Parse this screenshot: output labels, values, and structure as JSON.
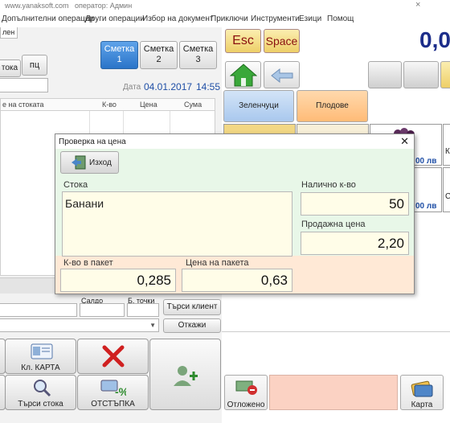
{
  "titlebar": {
    "site": "www.yanaksoft.com",
    "operator": "оператор: Админ",
    "close_symbol": "×"
  },
  "menu": [
    "Допълнителни операции",
    "Други операции",
    "Избор на документ",
    "Приключи",
    "Инструменти",
    "Езици",
    "Помощ"
  ],
  "tab_fragment": "лен",
  "left": {
    "stoka_fragment": "тока",
    "pc_label": "пц",
    "accounts": [
      {
        "title": "Сметка",
        "num": "1"
      },
      {
        "title": "Сметка",
        "num": "2"
      },
      {
        "title": "Сметка",
        "num": "3"
      }
    ],
    "date_label": "Дата",
    "date_value": "04.01.2017",
    "time_value": "14:55",
    "table_headers": [
      "е на стоката",
      "К-во",
      "Цена",
      "Сума"
    ],
    "saldo_label": "Салдо",
    "points_label": "Б. точки",
    "search_client": "Търси клиент",
    "cancel": "Откажи",
    "card_label": "Кл. КАРТА",
    "search_goods": "Търси стока",
    "discount": "ОТСТЪПКА"
  },
  "right": {
    "esc": "Esc",
    "space": "Space",
    "display_value": "0,0",
    "categories": [
      "Зеленчуци",
      "Плодове"
    ],
    "price_fragment_1": "00 лв",
    "price_fragment_2": "00 лв",
    "side_letter_1": "К",
    "side_letter_2": "С",
    "postponed": "Отложено",
    "card": "Карта"
  },
  "dialog": {
    "title": "Проверка на цена",
    "exit": "Изход",
    "goods_label": "Стока",
    "goods_value": "Банани",
    "stock_label": "Налично к-во",
    "stock_value": "50",
    "price_label": "Продажна цена",
    "price_value": "2,20",
    "pack_qty_label": "К-во в пакет",
    "pack_qty_value": "0,285",
    "pack_price_label": "Цена на пакета",
    "pack_price_value": "0,63"
  },
  "colors": {
    "accent_blue": "#2a74c8",
    "display_blue": "#1c2d8a",
    "dialog_green": "#e8f7e8",
    "dialog_peach": "#ffe9d6",
    "esc_bg": "#f5e08a",
    "fruit_tab": "#ffc993",
    "veg_tab": "#b9d3f2"
  }
}
